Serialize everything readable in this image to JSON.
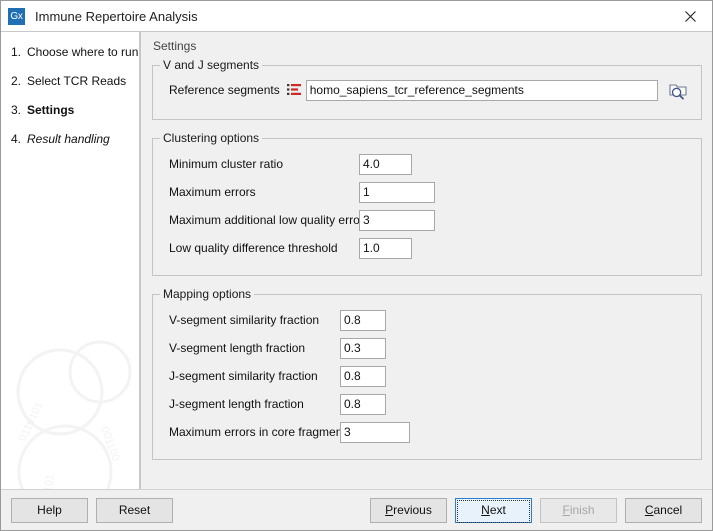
{
  "window": {
    "title": "Immune Repertoire Analysis",
    "app_icon": "gx-logo-icon",
    "icon_text": "Gx",
    "close_label": "close-icon",
    "accent_color": "#1f6fb5",
    "focus_border_color": "#2a7fd4"
  },
  "sidebar": {
    "steps": [
      {
        "num": "1.",
        "label": "Choose where to run",
        "state": "done"
      },
      {
        "num": "2.",
        "label": "Select TCR Reads",
        "state": "done"
      },
      {
        "num": "3.",
        "label": "Settings",
        "state": "current"
      },
      {
        "num": "4.",
        "label": "Result handling",
        "state": "future"
      }
    ]
  },
  "panel": {
    "title": "Settings",
    "groups": {
      "vj": {
        "title": "V and J segments",
        "reference": {
          "label": "Reference segments",
          "value": "homo_sapiens_tcr_reference_segments",
          "placeholder": "",
          "list_icon": "sequence-list-icon",
          "browse_icon": "folder-search-icon"
        }
      },
      "clustering": {
        "title": "Clustering options",
        "fields": [
          {
            "label": "Minimum cluster ratio",
            "value": "4.0",
            "width": 53
          },
          {
            "label": "Maximum errors",
            "value": "1",
            "width": 76
          },
          {
            "label": "Maximum additional low quality errors",
            "value": "3",
            "width": 76
          },
          {
            "label": "Low quality difference threshold",
            "value": "1.0",
            "width": 53
          }
        ]
      },
      "mapping": {
        "title": "Mapping options",
        "fields": [
          {
            "label": "V-segment similarity fraction",
            "value": "0.8",
            "width": 46
          },
          {
            "label": "V-segment length fraction",
            "value": "0.3",
            "width": 46
          },
          {
            "label": "J-segment similarity fraction",
            "value": "0.8",
            "width": 46
          },
          {
            "label": "J-segment length fraction",
            "value": "0.8",
            "width": 46
          },
          {
            "label": "Maximum errors in core fragment",
            "value": "3",
            "width": 70
          }
        ]
      }
    }
  },
  "footer": {
    "help": "Help",
    "reset": "Reset",
    "previous": {
      "pre": "",
      "mnemonic": "P",
      "post": "revious"
    },
    "next": {
      "pre": "",
      "mnemonic": "N",
      "post": "ext"
    },
    "finish": {
      "pre": "",
      "mnemonic": "F",
      "post": "inish"
    },
    "cancel": {
      "pre": "",
      "mnemonic": "C",
      "post": "ancel"
    }
  }
}
